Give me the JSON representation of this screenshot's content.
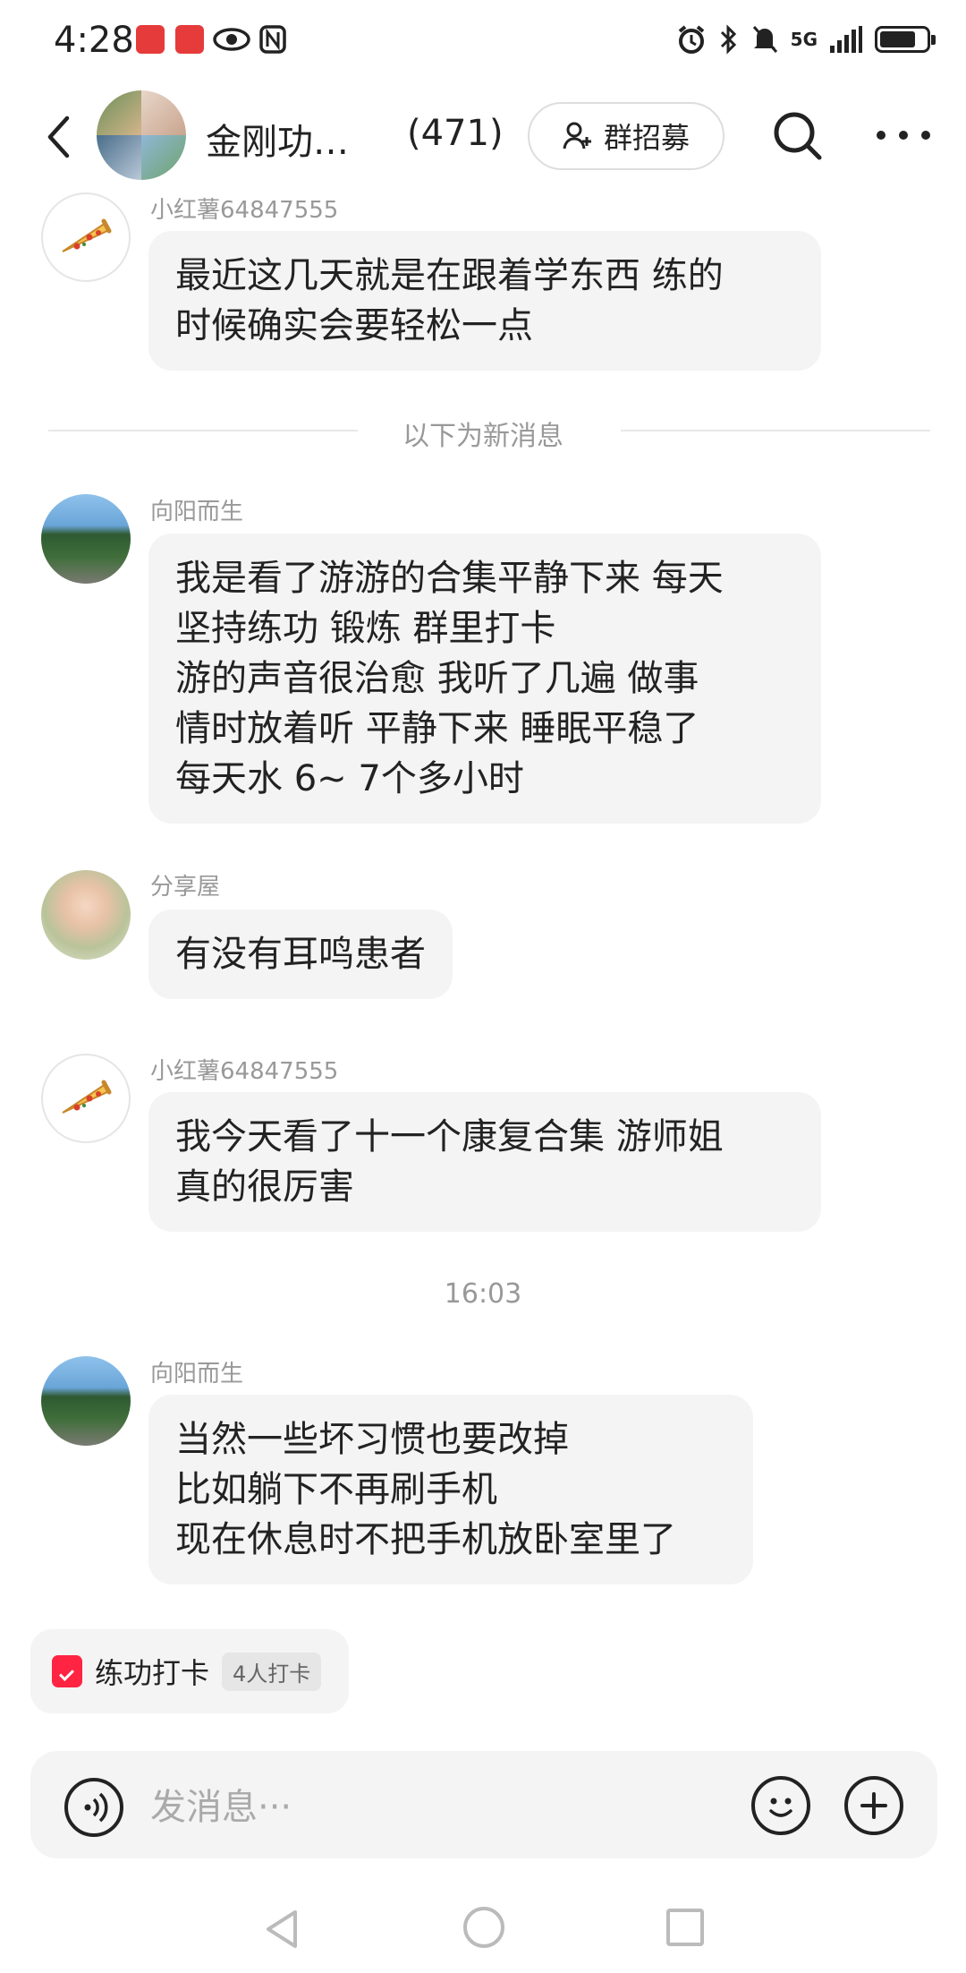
{
  "status_bar": {
    "time": "4:28",
    "network": "5G",
    "icons": [
      "huawei-app-icon",
      "xiaohongshu-app-icon",
      "eye-icon",
      "nfc-icon",
      "alarm-icon",
      "bluetooth-icon",
      "mute-icon",
      "signal-icon",
      "battery-icon"
    ]
  },
  "header": {
    "title": "金刚功…",
    "member_count": "(471)",
    "recruit_label": "群招募"
  },
  "messages": [
    {
      "sender": "小红薯64847555",
      "avatar": "pizza",
      "text": "最近这几天就是在跟着学东西  练的\n时候确实会要轻松一点"
    },
    {
      "sender": "向阳而生",
      "avatar": "road",
      "text": "我是看了游游的合集平静下来 每天\n坚持练功 锻炼   群里打卡\n游的声音很治愈   我听了几遍  做事\n情时放着听  平静下来 睡眠平稳了\n每天水 6~ 7个多小时"
    },
    {
      "sender": "分享屋",
      "avatar": "flower",
      "text": "有没有耳鸣患者"
    },
    {
      "sender": "小红薯64847555",
      "avatar": "pizza",
      "text": "我今天看了十一个康复合集 游师姐\n真的很厉害"
    },
    {
      "sender": "向阳而生",
      "avatar": "road",
      "text": "当然一些坏习惯也要改掉\n比如躺下不再刷手机\n现在休息时不把手机放卧室里了"
    }
  ],
  "divider_text": "以下为新消息",
  "timestamp": "16:03",
  "checkin": {
    "label": "练功打卡",
    "badge": "4人打卡"
  },
  "input": {
    "placeholder": "发消息···"
  },
  "colors": {
    "accent": "#ff2442",
    "bubble": "#f4f4f4",
    "meta_text": "#999999"
  }
}
